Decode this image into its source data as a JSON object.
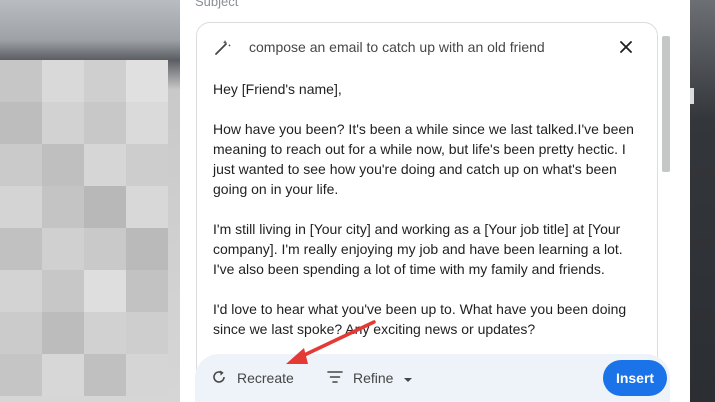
{
  "subject": {
    "label": "Subject"
  },
  "help_me_write": {
    "prompt": "compose an email to catch up with an old friend",
    "icons": {
      "prompt": "magic-wand-icon",
      "close": "close-icon"
    },
    "draft": [
      "Hey [Friend's name],",
      "How have you been? It's been a while since we last talked.I've been meaning to reach out for a while now, but life's been pretty hectic. I just wanted to see how you're doing and catch up on what's been going on in your life.",
      "I'm still living in [Your city] and working as a [Your job title] at [Your company]. I'm really enjoying my job and have been learning a lot. I've also been spending a lot of time with my family and friends.",
      "I'd love to hear what you've been up to. What have you been doing since we last spoke? Any exciting news or updates?"
    ]
  },
  "actions": {
    "recreate": "Recreate",
    "refine": "Refine",
    "insert": "Insert"
  },
  "colors": {
    "accent": "#1a73e8",
    "annotation_arrow": "#e53935",
    "action_bar_bg": "#eef2f9"
  }
}
